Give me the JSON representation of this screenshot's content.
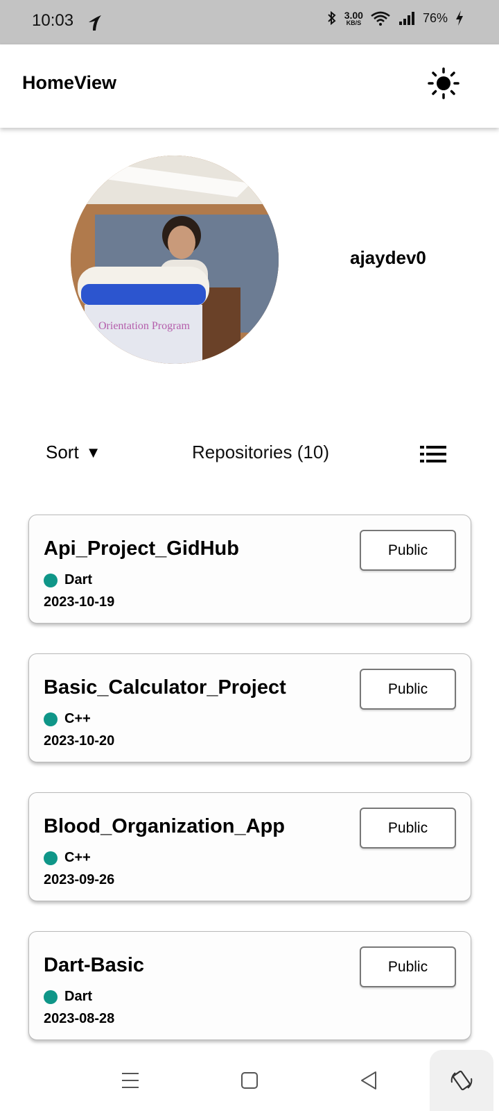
{
  "status_bar": {
    "time": "10:03",
    "net_speed_value": "3.00",
    "net_speed_unit": "KB/S",
    "battery": "76%"
  },
  "app_bar": {
    "title": "HomeView",
    "theme_icon": "sun-icon"
  },
  "profile": {
    "username": "ajaydev0"
  },
  "toolbar": {
    "sort_label": "Sort",
    "sort_caret": "▼",
    "repo_count": "Repositories (10)",
    "view_icon": "list-view-icon"
  },
  "repos": [
    {
      "name": "Api_Project_GidHub",
      "language": "Dart",
      "date": "2023-10-19",
      "visibility": "Public"
    },
    {
      "name": "Basic_Calculator_Project",
      "language": "C++",
      "date": "2023-10-20",
      "visibility": "Public"
    },
    {
      "name": "Blood_Organization_App",
      "language": "C++",
      "date": "2023-09-26",
      "visibility": "Public"
    },
    {
      "name": "Dart-Basic",
      "language": "Dart",
      "date": "2023-08-28",
      "visibility": "Public"
    }
  ],
  "colors": {
    "status_bar_bg": "#c3c3c3",
    "language_dot": "#0f9688"
  },
  "nav_bar": {
    "icons": [
      "menu-icon",
      "home-square-icon",
      "back-triangle-icon",
      "rotate-screen-icon"
    ]
  }
}
